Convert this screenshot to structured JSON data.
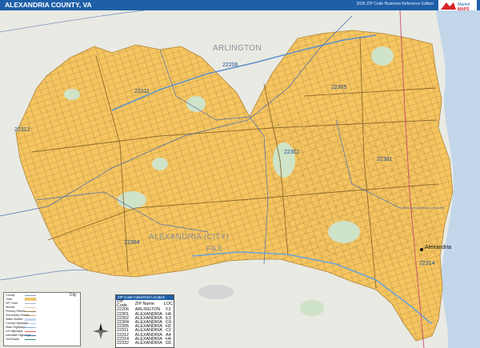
{
  "header": {
    "title": "ALEXANDRIA COUNTY, VA",
    "edition": "2026 ZIP Code Business Reference Edition",
    "logo_line1": "Market",
    "logo_line2": "MAPS"
  },
  "map": {
    "place_labels": [
      "ARLINGTON",
      "ALEXANDRIA (CITY)",
      "FAX"
    ],
    "city_label": "Alexandria",
    "zip_labels": [
      "22206",
      "22311",
      "22312",
      "22305",
      "22302",
      "22301",
      "22304",
      "22314"
    ],
    "colors": {
      "zip_area": "#f6c560",
      "background": "#e9eae3",
      "water": "#c3d6ea",
      "park": "#cfe3c8",
      "road": "#9a7b3a",
      "boundary": "#4f6fb0",
      "highway": "#6da4d8",
      "header": "#1f5fa8"
    }
  },
  "legend": {
    "items": [
      "County",
      "Town",
      "ZIP Code",
      "Streets",
      "Primary Streets",
      "Secondary Streets",
      "Water Bodies",
      "County Highways",
      "State Highways",
      "US Highways",
      "Interstate Highways",
      "Toll Roads"
    ],
    "city_symbol_text": "City"
  },
  "zip_table": {
    "header": "ZIP Code Index/Grid Location",
    "columns": [
      "ZIP Code",
      "ZIP Name",
      "LOC"
    ],
    "rows": [
      [
        "22206",
        "ARLINGTON",
        "F2"
      ],
      [
        "22301",
        "ALEXANDRIA",
        "H4"
      ],
      [
        "22302",
        "ALEXANDRIA",
        "E3"
      ],
      [
        "22304",
        "ALEXANDRIA",
        "C4"
      ],
      [
        "22305",
        "ALEXANDRIA",
        "H2"
      ],
      [
        "22311",
        "ALEXANDRIA",
        "C2"
      ],
      [
        "22312",
        "ALEXANDRIA",
        "A4"
      ],
      [
        "22314",
        "ALEXANDRIA",
        "H4"
      ],
      [
        "22332",
        "ALEXANDRIA",
        "G5"
      ]
    ]
  }
}
